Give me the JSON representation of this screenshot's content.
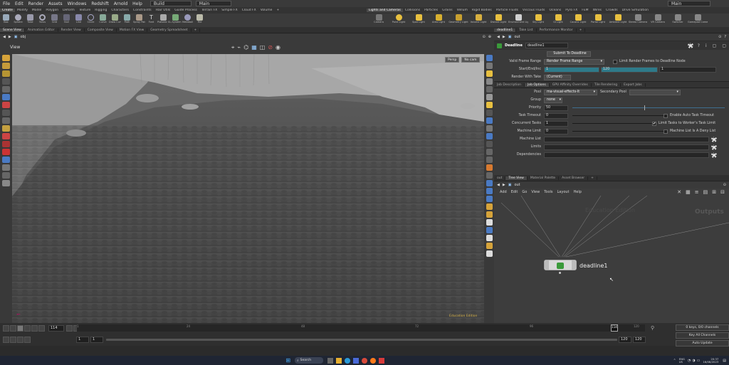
{
  "menubar": {
    "items": [
      "File",
      "Edit",
      "Render",
      "Assets",
      "Windows",
      "Redshift",
      "Arnold",
      "Help"
    ],
    "desktop": "Build",
    "desk_main": "Main",
    "right_main": "Main"
  },
  "shelf_tabs_left": [
    "Create",
    "Modify",
    "Model",
    "Polygon",
    "Deform",
    "Texture",
    "Rigging",
    "Characters",
    "Constraints",
    "Hair Utils",
    "Guide Process",
    "Terrain FX",
    "Simple FX",
    "Cloud FX",
    "Volume"
  ],
  "shelf_tabs_right": [
    "Lights and Cameras",
    "Collisions",
    "Particles",
    "Grains",
    "Vellum",
    "Rigid Bodies",
    "Particle Fluids",
    "Viscous Fluids",
    "Oceans",
    "Pyro FX",
    "FEM",
    "Wires",
    "Crowds",
    "Drive Simulation"
  ],
  "shelf_tools_left": [
    "Box",
    "Sphere",
    "Tube",
    "Torus",
    "Grid",
    "Null",
    "Line",
    "Circle",
    "Curve",
    "Draw Curve",
    "Path",
    "Spray Paint",
    "Font",
    "Platonic Solids",
    "L-System",
    "Metaball",
    "File"
  ],
  "shelf_tools_right": [
    "Camera",
    "Point Light",
    "Spot Light",
    "Area Light",
    "Geometry Light",
    "Volume Light",
    "Distant Light",
    "Environment Light",
    "Sky Light",
    "GI Light",
    "Caustic Light",
    "Portal Light",
    "Ambient Light",
    "Stereo Camera",
    "VR Camera",
    "Switcher",
    "Gamepad Camera"
  ],
  "left_pane_tabs": [
    "Scene View",
    "Animation Editor",
    "Render View",
    "Composite View",
    "Motion FX View",
    "Geometry Spreadsheet"
  ],
  "left_path": "obj",
  "viewport": {
    "label": "View",
    "persp": "Persp",
    "cam": "No cam",
    "watermark": "Education Edition"
  },
  "right_top_tabs": [
    "deadline1",
    "Take List",
    "Performance Monitor"
  ],
  "right_top_path": "out",
  "params": {
    "node_type": "Deadline",
    "node_name": "deadline1",
    "submit_label": "Submit To Deadline",
    "frame_range_label": "Valid Frame Range",
    "frame_range_value": "Render Frame Range",
    "limit_frames_label": "Limit Render Frames to Deadline Node",
    "startend_label": "Start/End/Inc",
    "start": "1",
    "end": "120",
    "inc": "1",
    "take_label": "Render With Take",
    "take_value": "(Current)",
    "sub_tabs": [
      "Job Description",
      "Job Options",
      "GPU Affinity Overrides",
      "Tile Rendering",
      "Export Jobs"
    ],
    "pool_label": "Pool",
    "pool_value": "ma-visual-effects-lt",
    "secondary_pool_label": "Secondary Pool",
    "group_label": "Group",
    "group_value": "none",
    "priority_label": "Priority",
    "priority_value": "50",
    "task_timeout_label": "Task Timeout",
    "task_timeout_value": "0",
    "auto_timeout_label": "Enable Auto Task Timeout",
    "concurrent_label": "Concurrent Tasks",
    "concurrent_value": "1",
    "limit_tasks_label": "Limit Tasks to Worker's Task Limit",
    "machine_limit_label": "Machine Limit",
    "machine_limit_value": "0",
    "deny_list_label": "Machine List Is A Deny List",
    "machine_list_label": "Machine List",
    "limits_label": "Limits",
    "dependencies_label": "Dependencies"
  },
  "net_tabs": [
    "out",
    "Tree View",
    "Material Palette",
    "Asset Browser"
  ],
  "net_path": "out",
  "net_menu": [
    "Add",
    "Edit",
    "Go",
    "View",
    "Tools",
    "Layout",
    "Help"
  ],
  "network": {
    "watermark": "Education Edition",
    "context": "Outputs",
    "node_label": "deadline1"
  },
  "timeline": {
    "frame": "114",
    "start": "1",
    "start2": "1",
    "end": "120",
    "end2": "120",
    "ticks": [
      "1",
      "24",
      "48",
      "72",
      "96",
      "120"
    ],
    "marker": "114",
    "keys_label": "0 keys, 0/0 channels",
    "key_all_label": "Key All Channels",
    "auto_update": "Auto Update"
  },
  "taskbar": {
    "search": "Search",
    "lang1": "ENG",
    "lang2": "US",
    "time": "20:37",
    "date": "16/08/2023"
  }
}
